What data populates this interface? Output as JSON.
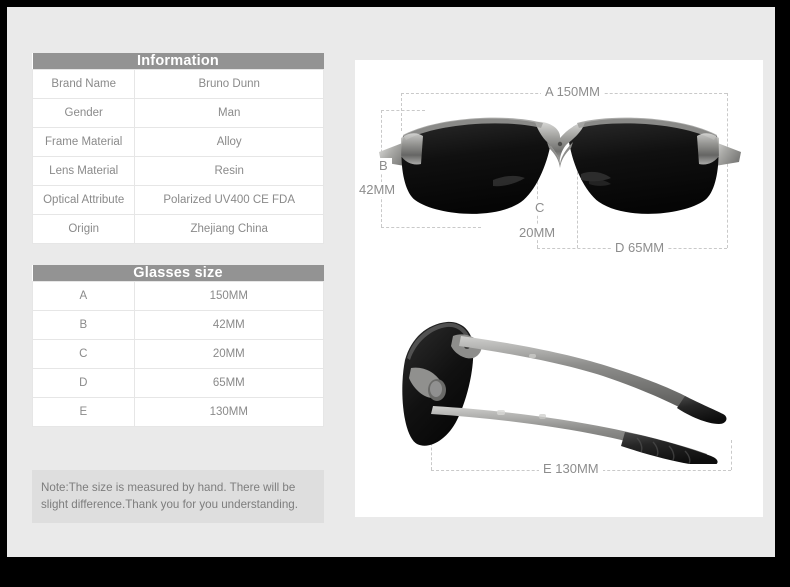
{
  "information_table": {
    "title": "Information",
    "rows": [
      {
        "label": "Brand Name",
        "value": "Bruno Dunn"
      },
      {
        "label": "Gender",
        "value": "Man"
      },
      {
        "label": "Frame Material",
        "value": "Alloy"
      },
      {
        "label": "Lens Material",
        "value": "Resin"
      },
      {
        "label": "Optical Attribute",
        "value": "Polarized UV400 CE FDA"
      },
      {
        "label": "Origin",
        "value": "Zhejiang China"
      }
    ]
  },
  "size_table": {
    "title": "Glasses size",
    "rows": [
      {
        "label": "A",
        "value": "150MM"
      },
      {
        "label": "B",
        "value": "42MM"
      },
      {
        "label": "C",
        "value": "20MM"
      },
      {
        "label": "D",
        "value": "65MM"
      },
      {
        "label": "E",
        "value": "130MM"
      }
    ]
  },
  "note": {
    "line1": "Note:The size is measured by hand. There will be",
    "line2": "slight difference.Thank you for you understanding."
  },
  "front_figure": {
    "label_a": "A  150MM",
    "label_b": "B",
    "label_b_value": "42MM",
    "label_c": "C",
    "label_c_value": "20MM",
    "label_d": "D  65MM"
  },
  "side_figure": {
    "label_e": "E  130MM"
  },
  "colors": {
    "page_background": "#eaeaea",
    "panel_background": "#ffffff",
    "table_header": "#939393",
    "table_text": "#8a8a8a",
    "note_background": "#dedede",
    "dash_line": "#c9c9c9",
    "dimension_text": "#8d8d8d",
    "lens_dark": "#1a1a1a",
    "frame_metal": "#9a9a98",
    "border": "#000000"
  }
}
